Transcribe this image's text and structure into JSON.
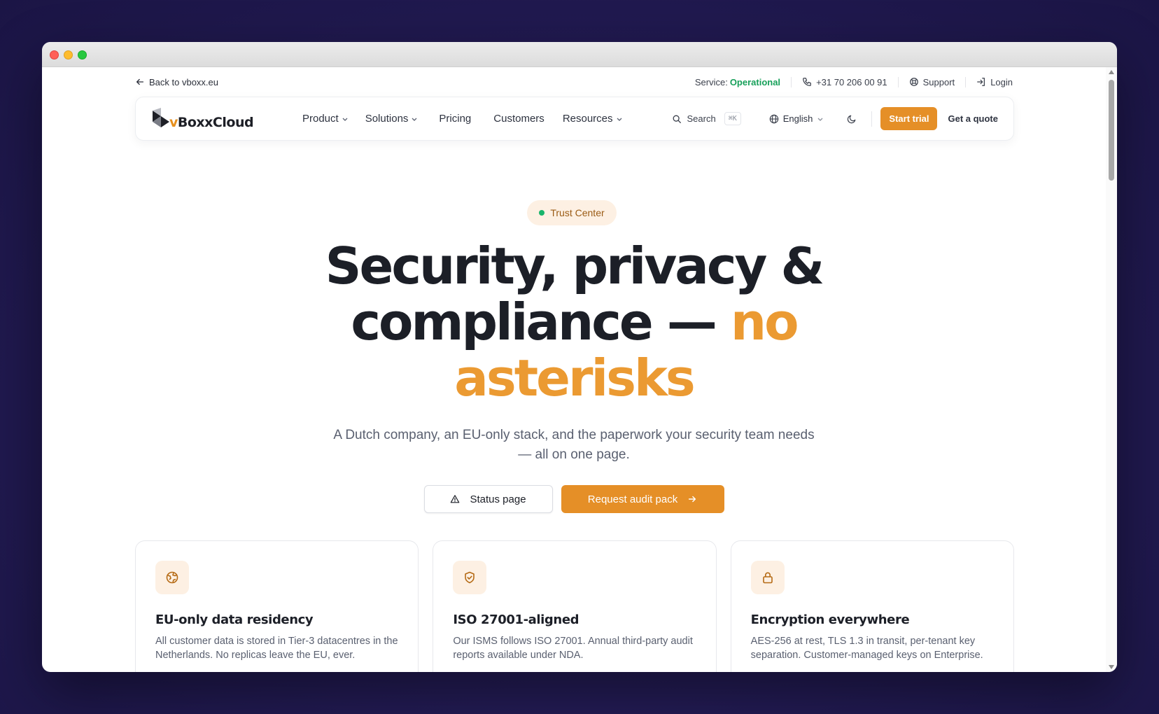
{
  "browser": {
    "controls": [
      "close",
      "minimize",
      "maximize"
    ]
  },
  "utility_bar": {
    "back_label": "Back to vboxx.eu",
    "service_label": "Service:",
    "service_status": "Operational",
    "phone": "+31 70 206 00 91",
    "support_label": "Support",
    "login_label": "Login"
  },
  "nav": {
    "logo_prefix": "v",
    "logo_name": "BoxxCloud",
    "links": [
      {
        "label": "Product",
        "dropdown": true
      },
      {
        "label": "Solutions",
        "dropdown": true
      },
      {
        "label": "Pricing",
        "dropdown": false
      },
      {
        "label": "Customers",
        "dropdown": false
      },
      {
        "label": "Resources",
        "dropdown": true
      }
    ],
    "search_label": "Search",
    "search_shortcut": "⌘K",
    "language": "English",
    "start_trial_label": "Start trial",
    "quote_label": "Get a quote"
  },
  "hero": {
    "badge": "Trust Center",
    "title_line1": "Security, privacy &",
    "title_line2_dark": "compliance — ",
    "title_line2_accent": "no",
    "title_line3_accent": "asterisks",
    "subtitle": "A Dutch company, an EU-only stack, and the paperwork your security team needs — all on one page.",
    "status_button": "Status page",
    "audit_button": "Request audit pack"
  },
  "cards": [
    {
      "icon": "globe-icon",
      "title": "EU-only data residency",
      "text": "All customer data is stored in Tier-3 datacentres in the Netherlands. No replicas leave the EU, ever."
    },
    {
      "icon": "shield-check-icon",
      "title": "ISO 27001-aligned",
      "text": "Our ISMS follows ISO 27001. Annual third-party audit reports available under NDA."
    },
    {
      "icon": "lock-icon",
      "title": "Encryption everywhere",
      "text": "AES-256 at rest, TLS 1.3 in transit, per-tenant key separation. Customer-managed keys on Enterprise."
    }
  ],
  "colors": {
    "accent": "#e58f27",
    "status_ok": "#17a05a",
    "text_dark": "#1c1f27",
    "background": "#241c57"
  }
}
